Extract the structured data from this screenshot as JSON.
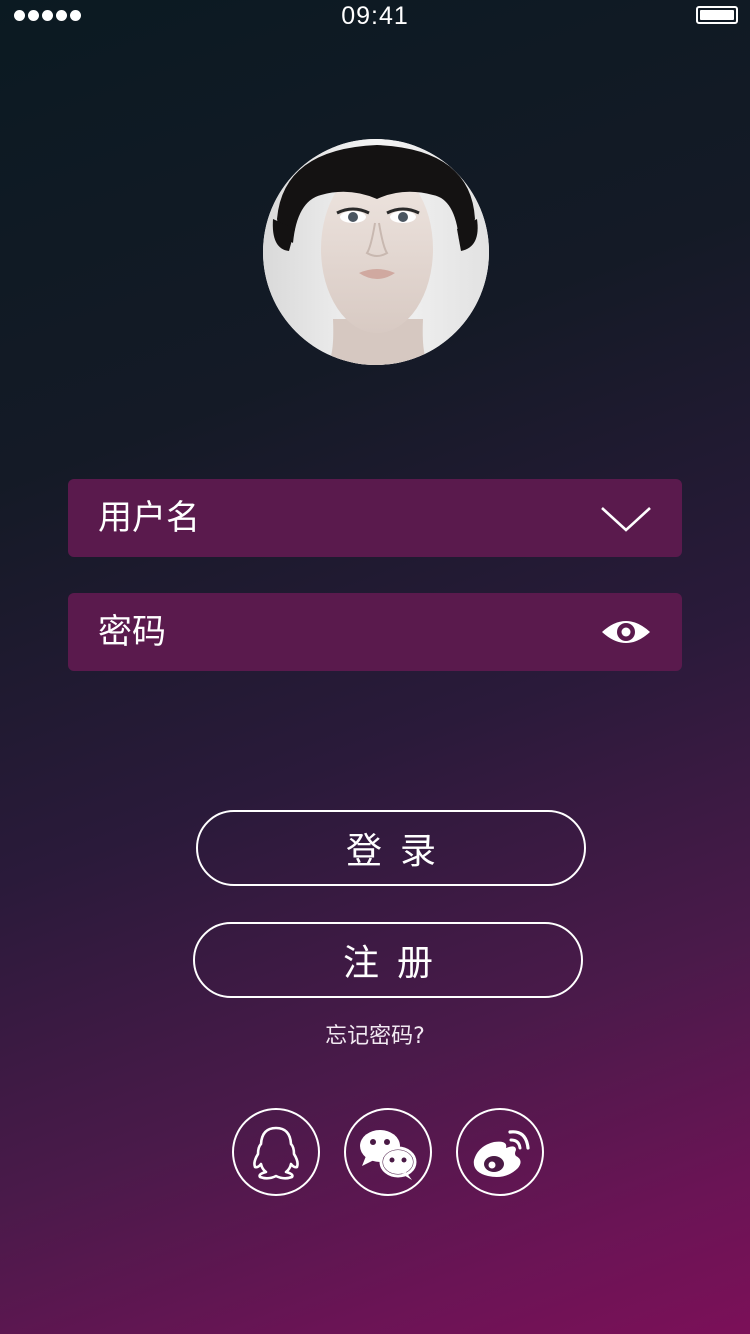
{
  "status_bar": {
    "time": "09:41"
  },
  "login_form": {
    "username_placeholder": "用户名",
    "password_placeholder": "密码",
    "login_label": "登录",
    "register_label": "注册",
    "forgot_label": "忘记密码?"
  },
  "icons": {
    "username_dropdown": "chevron-down-icon",
    "password_visibility": "eye-icon",
    "social": [
      "qq-icon",
      "wechat-icon",
      "weibo-icon"
    ]
  },
  "colors": {
    "field_background": "#5a1a4d",
    "background_top": "#0b1a22",
    "background_bottom": "#7b1058",
    "outline": "#ffffff"
  }
}
